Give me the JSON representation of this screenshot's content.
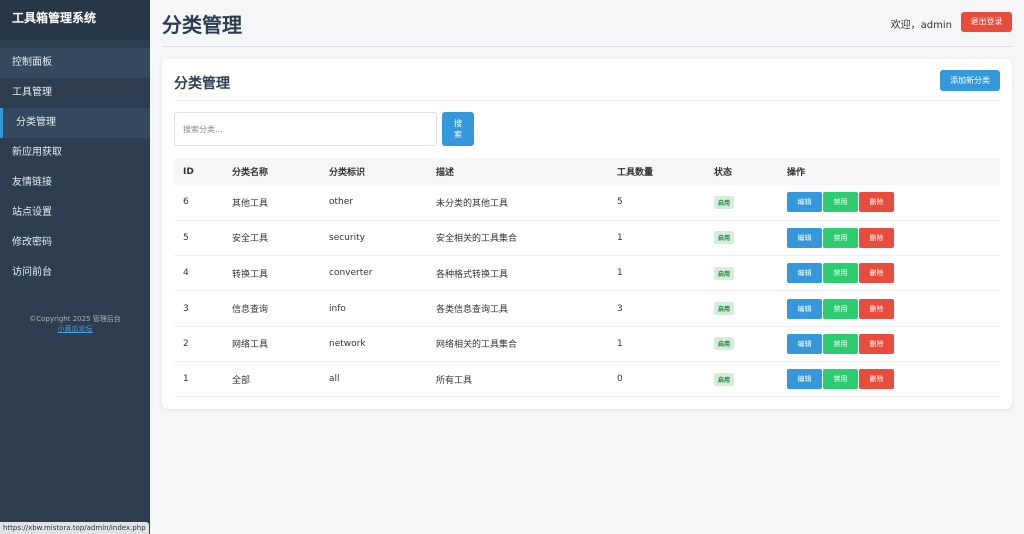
{
  "sidebar": {
    "brand": "工具箱管理系统",
    "items": [
      {
        "label": "控制面板"
      },
      {
        "label": "工具管理"
      },
      {
        "label": "分类管理"
      },
      {
        "label": "新应用获取"
      },
      {
        "label": "友情链接"
      },
      {
        "label": "站点设置"
      },
      {
        "label": "修改密码"
      },
      {
        "label": "访问前台"
      }
    ],
    "copyright": "©Copyright 2025 管理后台",
    "link_text": "小黄瓜论坛"
  },
  "status_url": "https://xbw.mistora.top/admin/index.php",
  "header": {
    "title": "分类管理",
    "welcome": "欢迎，admin",
    "logout": "退出登录"
  },
  "card": {
    "title": "分类管理",
    "add_button": "添加新分类",
    "search_placeholder": "搜索分类...",
    "search_button": "搜索"
  },
  "table": {
    "headers": [
      "ID",
      "分类名称",
      "分类标识",
      "描述",
      "工具数量",
      "状态",
      "操作"
    ],
    "rows": [
      {
        "id": "6",
        "name": "其他工具",
        "slug": "other",
        "desc": "未分类的其他工具",
        "count": "5",
        "status": "启用"
      },
      {
        "id": "5",
        "name": "安全工具",
        "slug": "security",
        "desc": "安全相关的工具集合",
        "count": "1",
        "status": "启用"
      },
      {
        "id": "4",
        "name": "转换工具",
        "slug": "converter",
        "desc": "各种格式转换工具",
        "count": "1",
        "status": "启用"
      },
      {
        "id": "3",
        "name": "信息查询",
        "slug": "info",
        "desc": "各类信息查询工具",
        "count": "3",
        "status": "启用"
      },
      {
        "id": "2",
        "name": "网络工具",
        "slug": "network",
        "desc": "网络相关的工具集合",
        "count": "1",
        "status": "启用"
      },
      {
        "id": "1",
        "name": "全部",
        "slug": "all",
        "desc": "所有工具",
        "count": "0",
        "status": "启用"
      }
    ],
    "actions": {
      "edit": "编辑",
      "disable": "禁用",
      "delete": "删除"
    }
  },
  "colors": {
    "sidebar": "#2c3e50",
    "primary": "#3498db",
    "success": "#2ecc71",
    "danger": "#e74c3c"
  }
}
